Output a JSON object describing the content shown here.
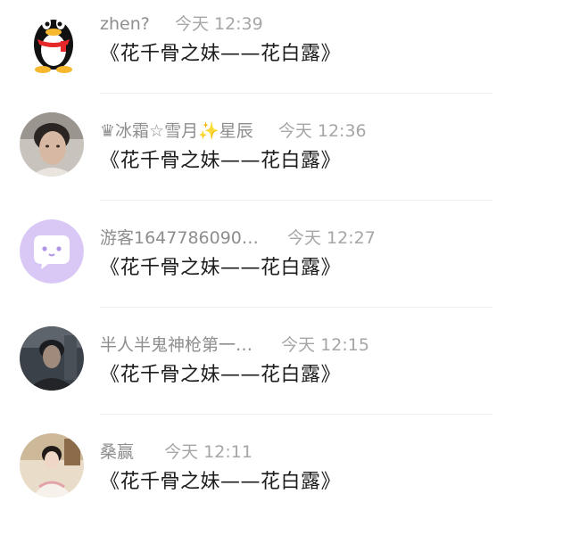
{
  "comments": [
    {
      "username": "zhen?",
      "time": "今天 12:39",
      "text": "《花千骨之妹——花白露》",
      "avatar": "qq-penguin-icon"
    },
    {
      "username": "♛冰霜☆雪月✨星辰",
      "time": "今天 12:36",
      "text": "《花千骨之妹——花白露》",
      "avatar": "user-photo-man"
    },
    {
      "username": "游客1647786090…",
      "time": "今天 12:27",
      "text": "《花千骨之妹——花白露》",
      "avatar": "guest-chat-bubble-icon"
    },
    {
      "username": "半人半鬼神枪第一…",
      "time": "今天 12:15",
      "text": "《花千骨之妹——花白露》",
      "avatar": "user-photo-dark"
    },
    {
      "username": "桑赢",
      "time": "今天 12:11",
      "text": "《花千骨之妹——花白露》",
      "avatar": "user-photo-woman"
    }
  ],
  "colors": {
    "username": "#8e8e8e",
    "time": "#a6a6a6",
    "text": "#1c1c1c",
    "guest_avatar_bg": "#d9c8f5",
    "divider": "#efefef"
  }
}
